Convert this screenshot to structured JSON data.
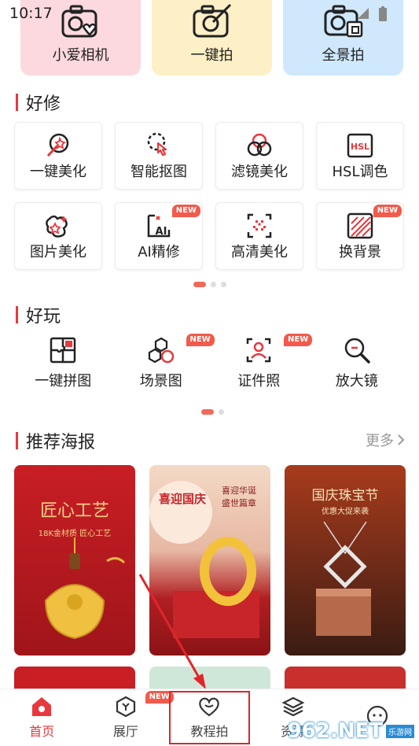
{
  "status": {
    "time": "10:17"
  },
  "top_features": [
    {
      "label": "小爱相机",
      "icon": "camera-heart-icon"
    },
    {
      "label": "一键拍",
      "icon": "camera-brush-icon"
    },
    {
      "label": "全景拍",
      "icon": "camera-panorama-icon"
    }
  ],
  "sections": {
    "good_edit": "好修",
    "good_fun": "好玩",
    "posters": "推荐海报",
    "more": "更多"
  },
  "edit_tools": [
    {
      "label": "一键美化",
      "icon": "magic-wand-icon",
      "badge": ""
    },
    {
      "label": "智能抠图",
      "icon": "smart-cutout-icon",
      "badge": ""
    },
    {
      "label": "滤镜美化",
      "icon": "filter-icon",
      "badge": ""
    },
    {
      "label": "HSL调色",
      "icon": "hsl-icon",
      "badge": "",
      "icon_text": "HSL"
    },
    {
      "label": "图片美化",
      "icon": "image-beautify-icon",
      "badge": ""
    },
    {
      "label": "AI精修",
      "icon": "ai-retouch-icon",
      "badge": "NEW",
      "icon_text": "AI"
    },
    {
      "label": "高清美化",
      "icon": "hd-enhance-icon",
      "badge": ""
    },
    {
      "label": "换背景",
      "icon": "change-background-icon",
      "badge": "NEW"
    }
  ],
  "fun_tools": [
    {
      "label": "一键拼图",
      "icon": "collage-icon",
      "badge": ""
    },
    {
      "label": "场景图",
      "icon": "scene-icon",
      "badge": "NEW"
    },
    {
      "label": "证件照",
      "icon": "id-photo-icon",
      "badge": "NEW"
    },
    {
      "label": "放大镜",
      "icon": "magnifier-icon",
      "badge": ""
    }
  ],
  "posters": [
    {
      "title": "匠心工艺",
      "subtitle": "18K金材质  匠心工艺"
    },
    {
      "title": "喜迎国庆",
      "subtitle": "喜迎华诞 盛世篇章"
    },
    {
      "title": "国庆珠宝节",
      "subtitle": "优惠大促来袭"
    }
  ],
  "bottom_nav": [
    {
      "label": "首页",
      "icon": "home-icon",
      "active": true,
      "badge": ""
    },
    {
      "label": "展厅",
      "icon": "gallery-icon",
      "active": false,
      "badge": "NEW"
    },
    {
      "label": "教程拍",
      "icon": "heart-tutorial-icon",
      "active": false,
      "badge": ""
    },
    {
      "label": "资源",
      "icon": "layers-icon",
      "active": false,
      "badge": ""
    },
    {
      "label": "",
      "icon": "profile-icon",
      "active": false,
      "badge": ""
    }
  ],
  "watermark": {
    "text": "962.NET",
    "sub": "乐游网"
  },
  "colors": {
    "accent": "#e8383d",
    "badge": "#f25a4b"
  }
}
